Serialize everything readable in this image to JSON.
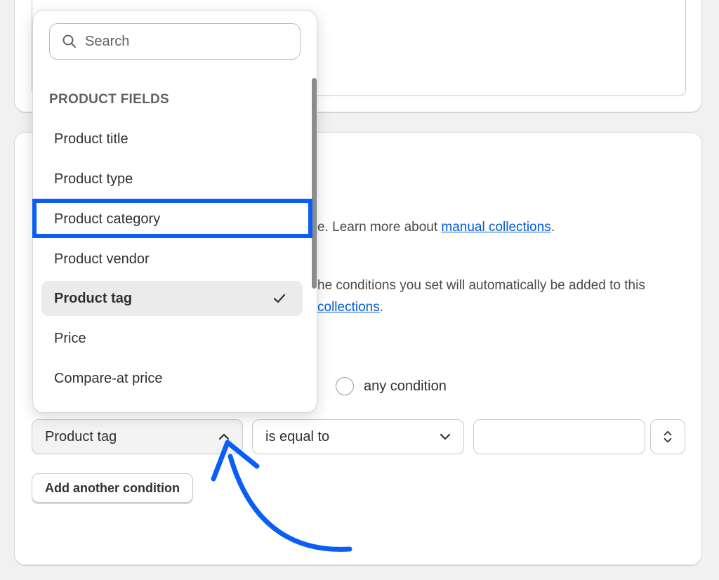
{
  "dropdown": {
    "search_placeholder": "Search",
    "section_label": "PRODUCT FIELDS",
    "options": [
      {
        "label": "Product title",
        "selected": false
      },
      {
        "label": "Product type",
        "selected": false
      },
      {
        "label": "Product category",
        "selected": false
      },
      {
        "label": "Product vendor",
        "selected": false
      },
      {
        "label": "Product tag",
        "selected": true
      },
      {
        "label": "Price",
        "selected": false
      },
      {
        "label": "Compare-at price",
        "selected": false
      }
    ]
  },
  "collection_type": {
    "manual_desc": "e. Learn more about ",
    "manual_link": "manual collections",
    "manual_end": ".",
    "auto_desc": "he conditions you set will automatically be added to this",
    "auto_link": "collections",
    "auto_end": "."
  },
  "conditions": {
    "match_any_label": "any condition",
    "field_value": "Product tag",
    "operator_value": "is equal to",
    "add_button": "Add another condition"
  },
  "colors": {
    "highlight": "#0a5df5",
    "link": "#005bd3"
  }
}
